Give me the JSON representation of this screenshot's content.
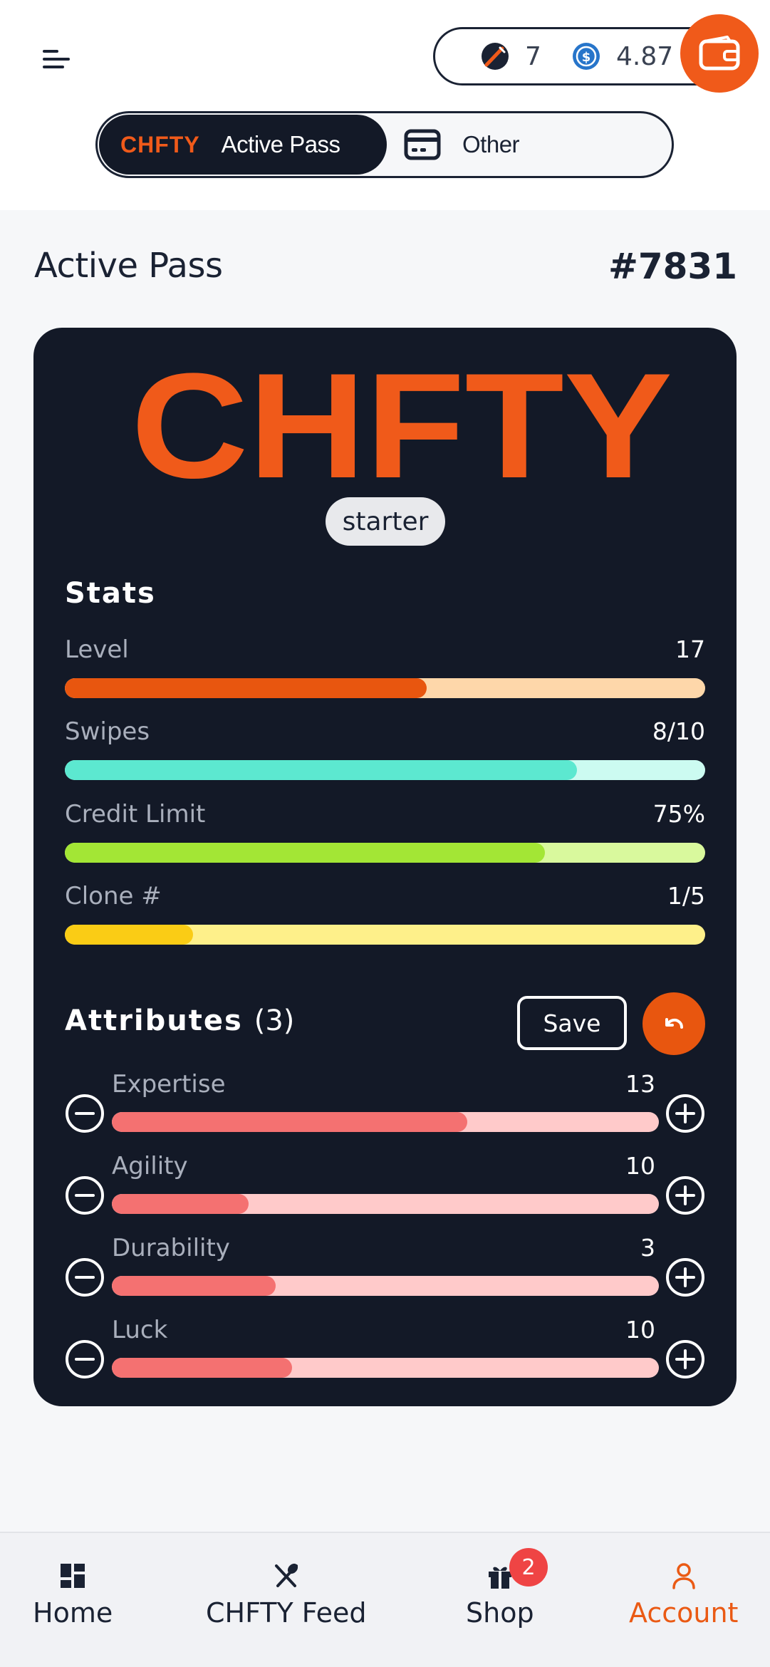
{
  "balances": {
    "chefs": "7",
    "usdc": "4.87"
  },
  "toggle": {
    "logo_text": "CHFTY",
    "active_label": "Active Pass",
    "other_label": "Other"
  },
  "header": {
    "title": "Active Pass",
    "pass_number": "#7831"
  },
  "card": {
    "logo_text": "CHFTY",
    "tier": "starter",
    "stats_title": "Stats",
    "stats": [
      {
        "label": "Level",
        "value": "17",
        "fill_pct": 56.5,
        "fill_color": "#e8560f",
        "track_color": "#fed7aa"
      },
      {
        "label": "Swipes",
        "value": "8/10",
        "fill_pct": 80,
        "fill_color": "#5ce8d0",
        "track_color": "#ccfbf1"
      },
      {
        "label": "Credit Limit",
        "value": "75%",
        "fill_pct": 75,
        "fill_color": "#a3e635",
        "track_color": "#d9f99d"
      },
      {
        "label": "Clone #",
        "value": "1/5",
        "fill_pct": 20,
        "fill_color": "#facc15",
        "track_color": "#fef08a"
      }
    ],
    "attributes_title": "Attributes",
    "attributes_count": "(3)",
    "save_label": "Save",
    "attributes": [
      {
        "label": "Expertise",
        "value": "13",
        "fill_pct": 65
      },
      {
        "label": "Agility",
        "value": "10",
        "fill_pct": 25
      },
      {
        "label": "Durability",
        "value": "3",
        "fill_pct": 30
      },
      {
        "label": "Luck",
        "value": "10",
        "fill_pct": 33
      }
    ]
  },
  "nav": {
    "home": "Home",
    "feed": "CHFTY Feed",
    "shop": "Shop",
    "shop_badge": "2",
    "account": "Account",
    "active": "account"
  },
  "colors": {
    "accent": "#f05a1a",
    "card_bg": "#131927",
    "attr_fill": "#f47171",
    "attr_track": "#ffcaca"
  }
}
